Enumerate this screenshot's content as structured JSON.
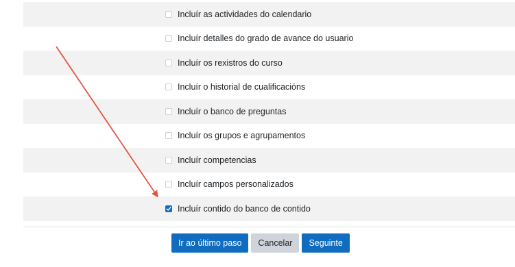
{
  "options": [
    {
      "label": "Incluír as actividades do calendario",
      "checked": false
    },
    {
      "label": "Incluír detalles do grado de avance do usuario",
      "checked": false
    },
    {
      "label": "Incluír os rexistros do curso",
      "checked": false
    },
    {
      "label": "Incluír o historial de cualificacións",
      "checked": false
    },
    {
      "label": "Incluír o banco de preguntas",
      "checked": false
    },
    {
      "label": "Incluír os grupos e agrupamentos",
      "checked": false
    },
    {
      "label": "Incluír competencias",
      "checked": false
    },
    {
      "label": "Incluír campos personalizados",
      "checked": false
    },
    {
      "label": "Incluír contido do banco de contido",
      "checked": true
    }
  ],
  "buttons": {
    "jump_to_final": "Ir ao último paso",
    "cancel": "Cancelar",
    "next": "Seguinte"
  },
  "colors": {
    "primary": "#0f6cbf",
    "secondary": "#ced4da",
    "stripe": "#f2f2f2",
    "annotation_arrow": "#e8533f"
  },
  "annotation": {
    "icon": "red-arrow-icon"
  }
}
